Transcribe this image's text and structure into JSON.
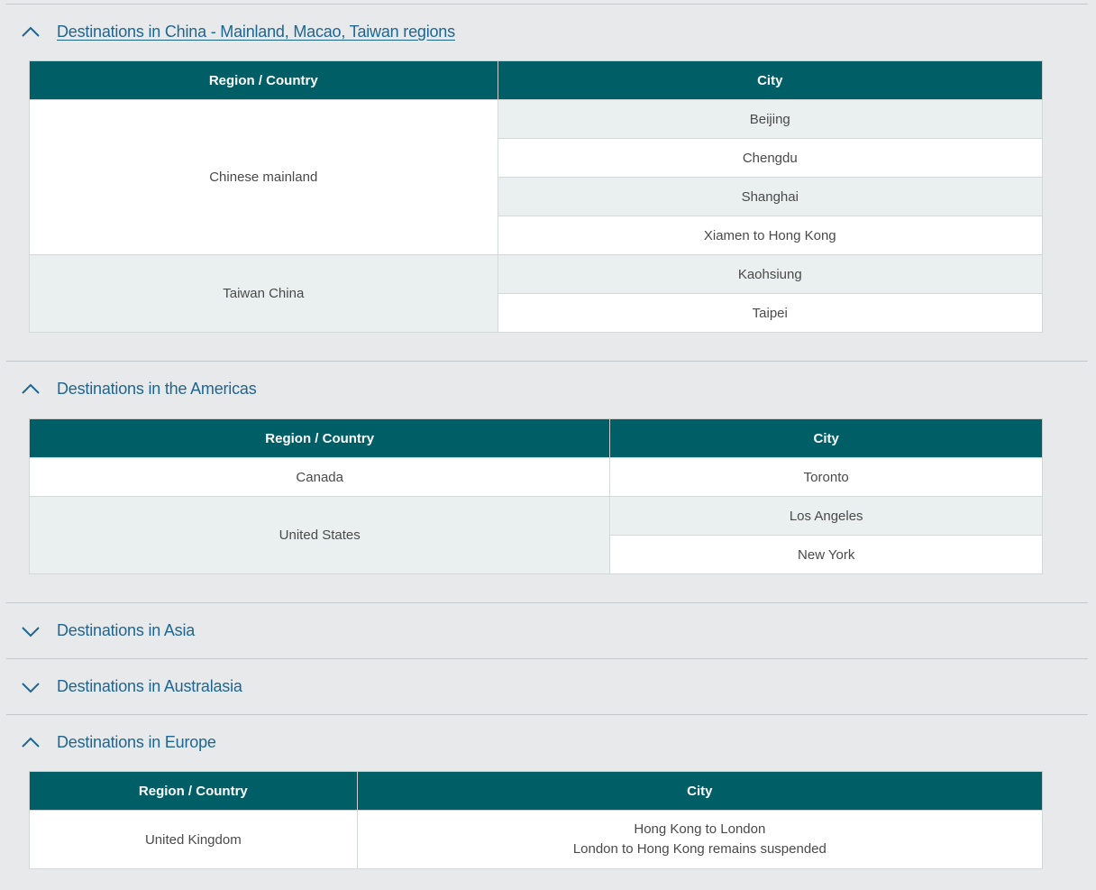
{
  "sections": [
    {
      "title": "Destinations in China - Mainland, Macao, Taiwan regions",
      "expanded": true,
      "header": {
        "region": "Region / Country",
        "city": "City"
      },
      "rows": [
        {
          "region": "Chinese mainland",
          "cities": [
            "Beijing",
            "Chengdu",
            "Shanghai",
            "Xiamen to Hong Kong"
          ]
        },
        {
          "region": "Taiwan China",
          "cities": [
            "Kaohsiung",
            "Taipei"
          ]
        }
      ]
    },
    {
      "title": "Destinations in the Americas",
      "expanded": true,
      "header": {
        "region": "Region / Country",
        "city": "City"
      },
      "rows": [
        {
          "region": "Canada",
          "cities": [
            "Toronto"
          ]
        },
        {
          "region": "United States",
          "cities": [
            "Los Angeles",
            "New York"
          ]
        }
      ]
    },
    {
      "title": "Destinations in Asia",
      "expanded": false
    },
    {
      "title": "Destinations in Australasia",
      "expanded": false
    },
    {
      "title": "Destinations in Europe",
      "expanded": true,
      "header": {
        "region": "Region / Country",
        "city": "City"
      },
      "rows": [
        {
          "region": "United Kingdom",
          "cities": [
            "Hong Kong to London",
            "London to Hong Kong remains suspended"
          ]
        }
      ]
    }
  ],
  "colors": {
    "header_bg": "#005f66",
    "link": "#1e6690",
    "alt_row": "#eaf0ef",
    "page_bg": "#e8e9eb"
  },
  "icons": {
    "expanded": "chevron-up-icon",
    "collapsed": "chevron-down-icon"
  }
}
